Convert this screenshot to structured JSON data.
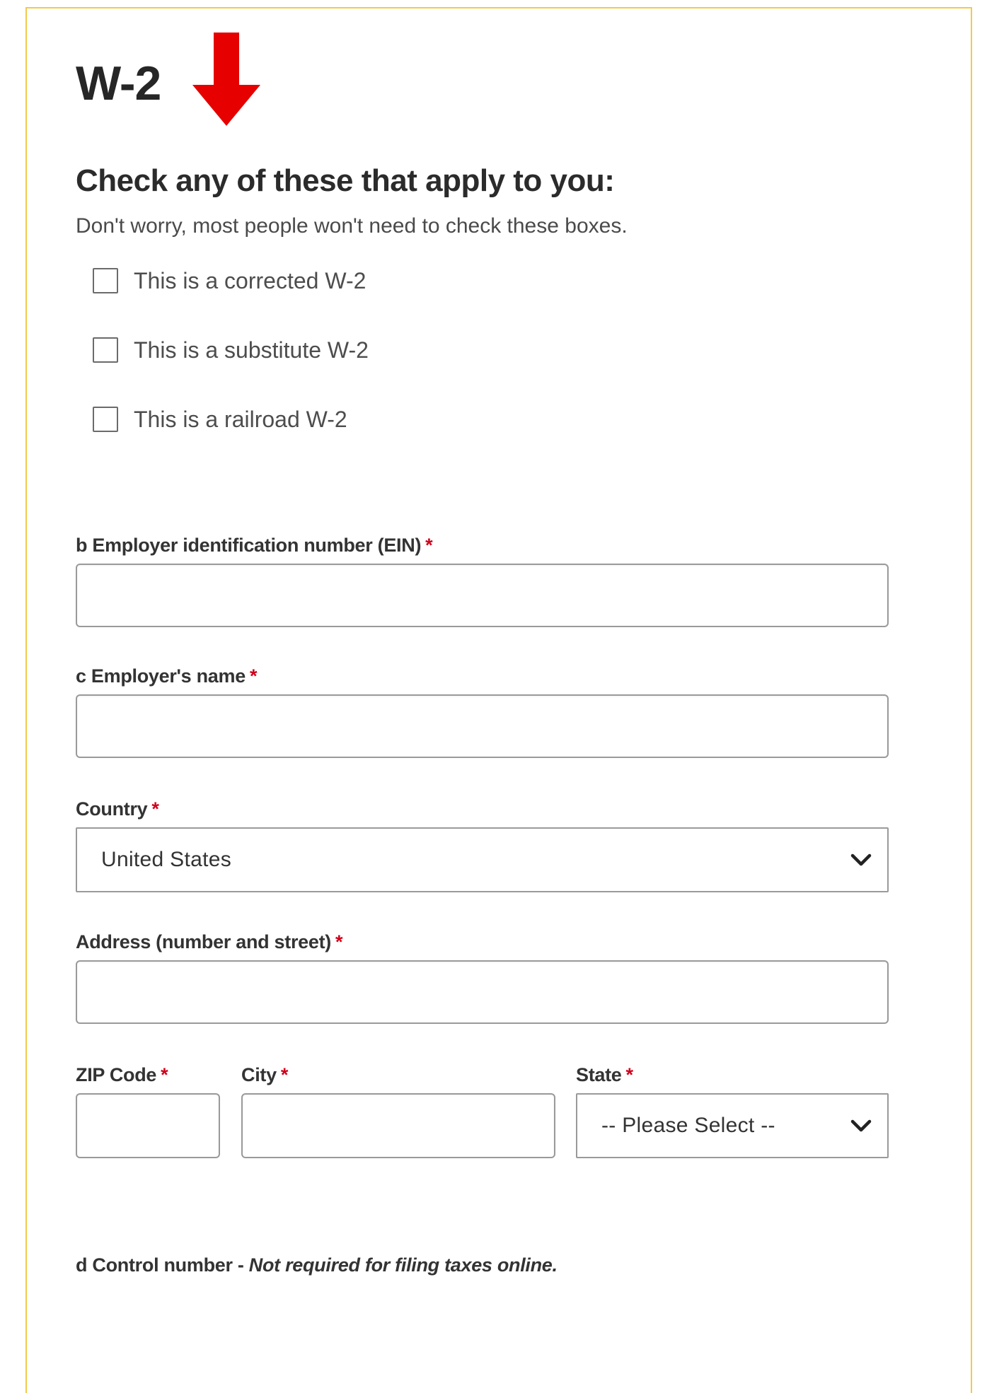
{
  "form": {
    "title": "W-2",
    "heading": "Check any of these that apply to you:",
    "note": "Don't worry, most people won't need to check these boxes.",
    "checkboxes": [
      {
        "label": "This is a corrected W-2",
        "checked": false
      },
      {
        "label": "This is a substitute W-2",
        "checked": false
      },
      {
        "label": "This is a railroad W-2",
        "checked": false
      }
    ],
    "fields": {
      "ein": {
        "label": "b Employer identification number (EIN)",
        "required_mark": "*",
        "value": ""
      },
      "employer_name": {
        "label": "c Employer's name",
        "required_mark": "*",
        "value": ""
      },
      "country": {
        "label": "Country",
        "required_mark": "*",
        "value": "United States"
      },
      "address": {
        "label": "Address (number and street)",
        "required_mark": "*",
        "value": ""
      },
      "zip": {
        "label": "ZIP Code",
        "required_mark": "*",
        "value": ""
      },
      "city": {
        "label": "City",
        "required_mark": "*",
        "value": ""
      },
      "state": {
        "label": "State",
        "required_mark": "*",
        "value": "-- Please Select --"
      }
    },
    "control_number": {
      "label": "d Control number - ",
      "note": "Not required for filing taxes online."
    }
  },
  "colors": {
    "panel_border": "#f2c94c",
    "arrow": "#e60000",
    "required": "#d0021b"
  },
  "icons": {
    "arrow": "down-arrow-icon",
    "dropdown": "chevron-down-icon"
  }
}
